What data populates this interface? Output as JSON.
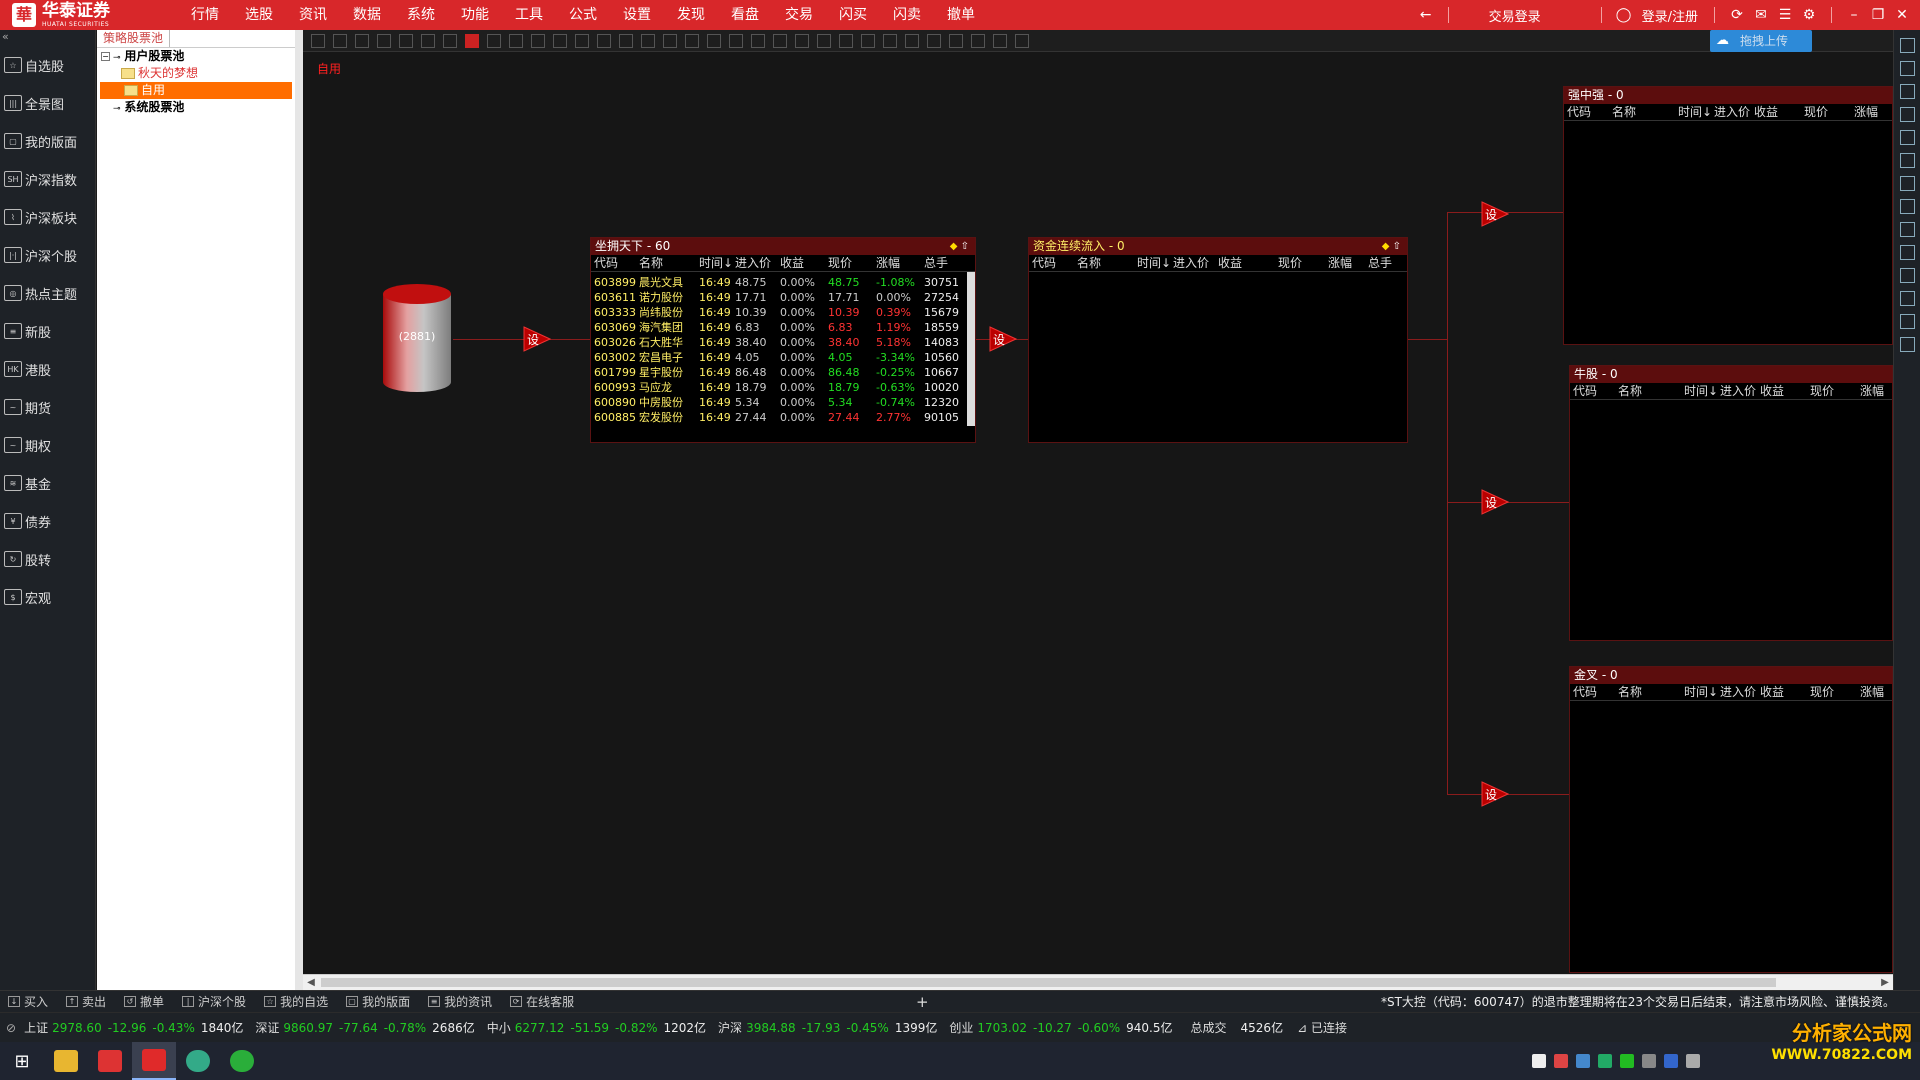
{
  "app": {
    "logo_cn": "华泰证券",
    "logo_en": "HUATAI SECURITIES",
    "menu": [
      "行情",
      "选股",
      "资讯",
      "数据",
      "系统",
      "功能",
      "工具",
      "公式",
      "设置",
      "发现",
      "看盘",
      "交易",
      "闪买",
      "闪卖",
      "撤单"
    ],
    "trade_login": "交易登录",
    "login_register": "登录/注册"
  },
  "leftnav": {
    "items": [
      {
        "icon": "☆",
        "label": "自选股"
      },
      {
        "icon": "|||",
        "label": "全景图"
      },
      {
        "icon": "▢",
        "label": "我的版面"
      },
      {
        "icon": "SH",
        "label": "沪深指数"
      },
      {
        "icon": "⌇",
        "label": "沪深板块"
      },
      {
        "icon": "|·|",
        "label": "沪深个股"
      },
      {
        "icon": "◎",
        "label": "热点主题"
      },
      {
        "icon": "≡",
        "label": "新股"
      },
      {
        "icon": "HK",
        "label": "港股"
      },
      {
        "icon": "~",
        "label": "期货"
      },
      {
        "icon": "~",
        "label": "期权"
      },
      {
        "icon": "≋",
        "label": "基金"
      },
      {
        "icon": "¥",
        "label": "债券"
      },
      {
        "icon": "↻",
        "label": "股转"
      },
      {
        "icon": "$",
        "label": "宏观"
      }
    ]
  },
  "tree": {
    "tab": "策略股票池",
    "user_pool": "用户股票池",
    "child1": "秋天的梦想",
    "child2": "自用",
    "system_pool": "系统股票池"
  },
  "toolbar": {
    "upload": "拖拽上传"
  },
  "canvas": {
    "label": "自用",
    "cylinder_count": "(2881)",
    "set_label": "设"
  },
  "panel_main": {
    "title": "坐拥天下 - 60",
    "headers": [
      "代码",
      "名称",
      "时间↓",
      "进入价",
      "收益",
      "现价",
      "涨幅",
      "总手"
    ],
    "rows": [
      {
        "code": "603899",
        "name": "晨光文具",
        "time": "16:49",
        "in": "48.75",
        "pct": "0.00%",
        "price": "48.75",
        "chg": "-1.08%",
        "dir": "dn",
        "vol": "30751"
      },
      {
        "code": "603611",
        "name": "诺力股份",
        "time": "16:49",
        "in": "17.71",
        "pct": "0.00%",
        "price": "17.71",
        "chg": "0.00%",
        "dir": "fl",
        "vol": "27254"
      },
      {
        "code": "603333",
        "name": "尚纬股份",
        "time": "16:49",
        "in": "10.39",
        "pct": "0.00%",
        "price": "10.39",
        "chg": "0.39%",
        "dir": "up",
        "vol": "15679"
      },
      {
        "code": "603069",
        "name": "海汽集团",
        "time": "16:49",
        "in": "6.83",
        "pct": "0.00%",
        "price": "6.83",
        "chg": "1.19%",
        "dir": "up",
        "vol": "18559"
      },
      {
        "code": "603026",
        "name": "石大胜华",
        "time": "16:49",
        "in": "38.40",
        "pct": "0.00%",
        "price": "38.40",
        "chg": "5.18%",
        "dir": "up",
        "vol": "14083"
      },
      {
        "code": "603002",
        "name": "宏昌电子",
        "time": "16:49",
        "in": "4.05",
        "pct": "0.00%",
        "price": "4.05",
        "chg": "-3.34%",
        "dir": "dn",
        "vol": "10560"
      },
      {
        "code": "601799",
        "name": "星宇股份",
        "time": "16:49",
        "in": "86.48",
        "pct": "0.00%",
        "price": "86.48",
        "chg": "-0.25%",
        "dir": "dn",
        "vol": "10667"
      },
      {
        "code": "600993",
        "name": "马应龙",
        "time": "16:49",
        "in": "18.79",
        "pct": "0.00%",
        "price": "18.79",
        "chg": "-0.63%",
        "dir": "dn",
        "vol": "10020"
      },
      {
        "code": "600890",
        "name": "中房股份",
        "time": "16:49",
        "in": "5.34",
        "pct": "0.00%",
        "price": "5.34",
        "chg": "-0.74%",
        "dir": "dn",
        "vol": "12320"
      },
      {
        "code": "600885",
        "name": "宏发股份",
        "time": "16:49",
        "in": "27.44",
        "pct": "0.00%",
        "price": "27.44",
        "chg": "2.77%",
        "dir": "up",
        "vol": "90105"
      }
    ]
  },
  "panel_flow": {
    "title": "资金连续流入 - 0",
    "headers": [
      "代码",
      "名称",
      "时间↓",
      "进入价",
      "收益",
      "现价",
      "涨幅",
      "总手"
    ]
  },
  "panel_strong": {
    "title": "强中强 - 0",
    "headers": [
      "代码",
      "名称",
      "时间↓",
      "进入价",
      "收益",
      "现价",
      "涨幅"
    ]
  },
  "panel_bull": {
    "title": "牛股 - 0",
    "headers": [
      "代码",
      "名称",
      "时间↓",
      "进入价",
      "收益",
      "现价",
      "涨幅"
    ]
  },
  "panel_cross": {
    "title": "金叉 - 0",
    "headers": [
      "代码",
      "名称",
      "时间↓",
      "进入价",
      "收益",
      "现价",
      "涨幅"
    ]
  },
  "actbar": {
    "items": [
      "买入",
      "卖出",
      "撤单",
      "沪深个股",
      "我的自选",
      "我的版面",
      "我的资讯",
      "在线客服"
    ],
    "notice": "*ST大控（代码：600747）的退市整理期将在23个交易日后结束，请注意市场风险、谨慎投资。"
  },
  "indexbar": {
    "items": [
      {
        "name": "上证",
        "value": "2978.60",
        "change": "-12.96",
        "pct": "-0.43%",
        "amount": "1840亿"
      },
      {
        "name": "深证",
        "value": "9860.97",
        "change": "-77.64",
        "pct": "-0.78%",
        "amount": "2686亿"
      },
      {
        "name": "中小",
        "value": "6277.12",
        "change": "-51.59",
        "pct": "-0.82%",
        "amount": "1202亿"
      },
      {
        "name": "沪深",
        "value": "3984.88",
        "change": "-17.93",
        "pct": "-0.45%",
        "amount": "1399亿"
      },
      {
        "name": "创业",
        "value": "1703.02",
        "change": "-10.27",
        "pct": "-0.60%",
        "amount": "940.5亿"
      }
    ],
    "total_label": "总成交",
    "total_value": "4526亿",
    "connection": "已连接"
  },
  "watermark": {
    "line1": "分析家公式网",
    "line2": "WWW.70822.COM"
  },
  "colors": {
    "brand_red": "#d8272a",
    "up": "#ff3333",
    "down": "#22dd22",
    "tree_selected": "#ff6d00"
  }
}
